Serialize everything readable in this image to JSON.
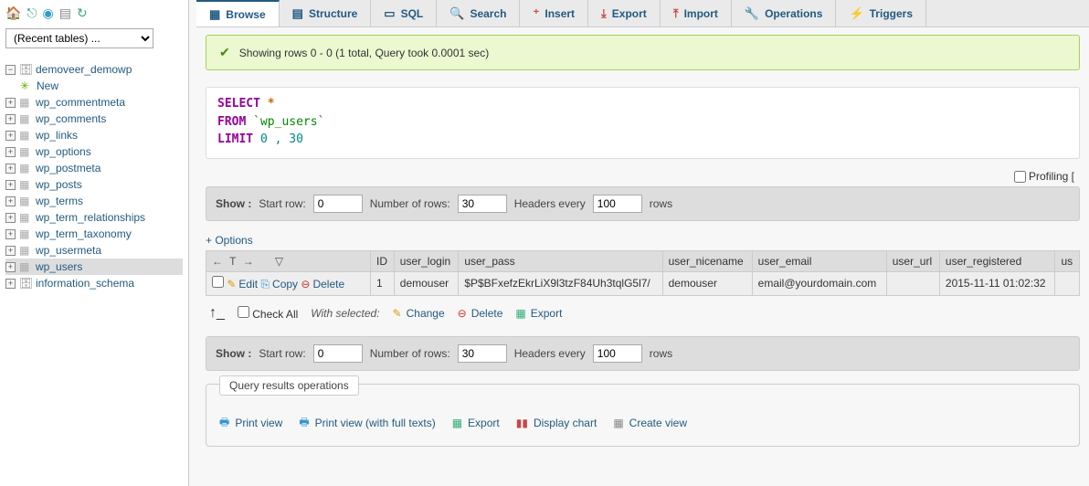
{
  "sidebar": {
    "recent_placeholder": "(Recent tables) ...",
    "db_name": "demoveer_demowp",
    "new_label": "New",
    "tables": [
      "wp_commentmeta",
      "wp_comments",
      "wp_links",
      "wp_options",
      "wp_postmeta",
      "wp_posts",
      "wp_terms",
      "wp_term_relationships",
      "wp_term_taxonomy",
      "wp_usermeta",
      "wp_users"
    ],
    "selected": "wp_users",
    "schema": "information_schema"
  },
  "tabs": {
    "browse": "Browse",
    "structure": "Structure",
    "sql": "SQL",
    "search": "Search",
    "insert": "Insert",
    "export": "Export",
    "import": "Import",
    "operations": "Operations",
    "triggers": "Triggers"
  },
  "success": "Showing rows 0 - 0 (1 total, Query took 0.0001 sec)",
  "sql": {
    "select": "SELECT",
    "star": "*",
    "from": "FROM",
    "table": "`wp_users`",
    "limit": "LIMIT",
    "nums": "0 , 30"
  },
  "profiling_label": "Profiling [",
  "show_bar": {
    "show": "Show :",
    "start_row": "Start row:",
    "start_val": "0",
    "num_rows": "Number of rows:",
    "num_val": "30",
    "headers": "Headers every",
    "headers_val": "100",
    "rows": "rows"
  },
  "options": "+ Options",
  "columns": [
    "ID",
    "user_login",
    "user_pass",
    "user_nicename",
    "user_email",
    "user_url",
    "user_registered",
    "us"
  ],
  "row": {
    "edit": "Edit",
    "copy": "Copy",
    "delete": "Delete",
    "id": "1",
    "login": "demouser",
    "pass": "$P$BFxefzEkrLiX9l3tzF84Uh3tqlG5l7/",
    "nicename": "demouser",
    "email": "email@yourdomain.com",
    "url": "",
    "registered": "2015-11-11 01:02:32"
  },
  "row_ops": {
    "check_all": "Check All",
    "with_selected": "With selected:",
    "change": "Change",
    "delete": "Delete",
    "export": "Export"
  },
  "fieldset": {
    "legend": "Query results operations",
    "print": "Print view",
    "print_full": "Print view (with full texts)",
    "export": "Export",
    "chart": "Display chart",
    "create_view": "Create view"
  }
}
